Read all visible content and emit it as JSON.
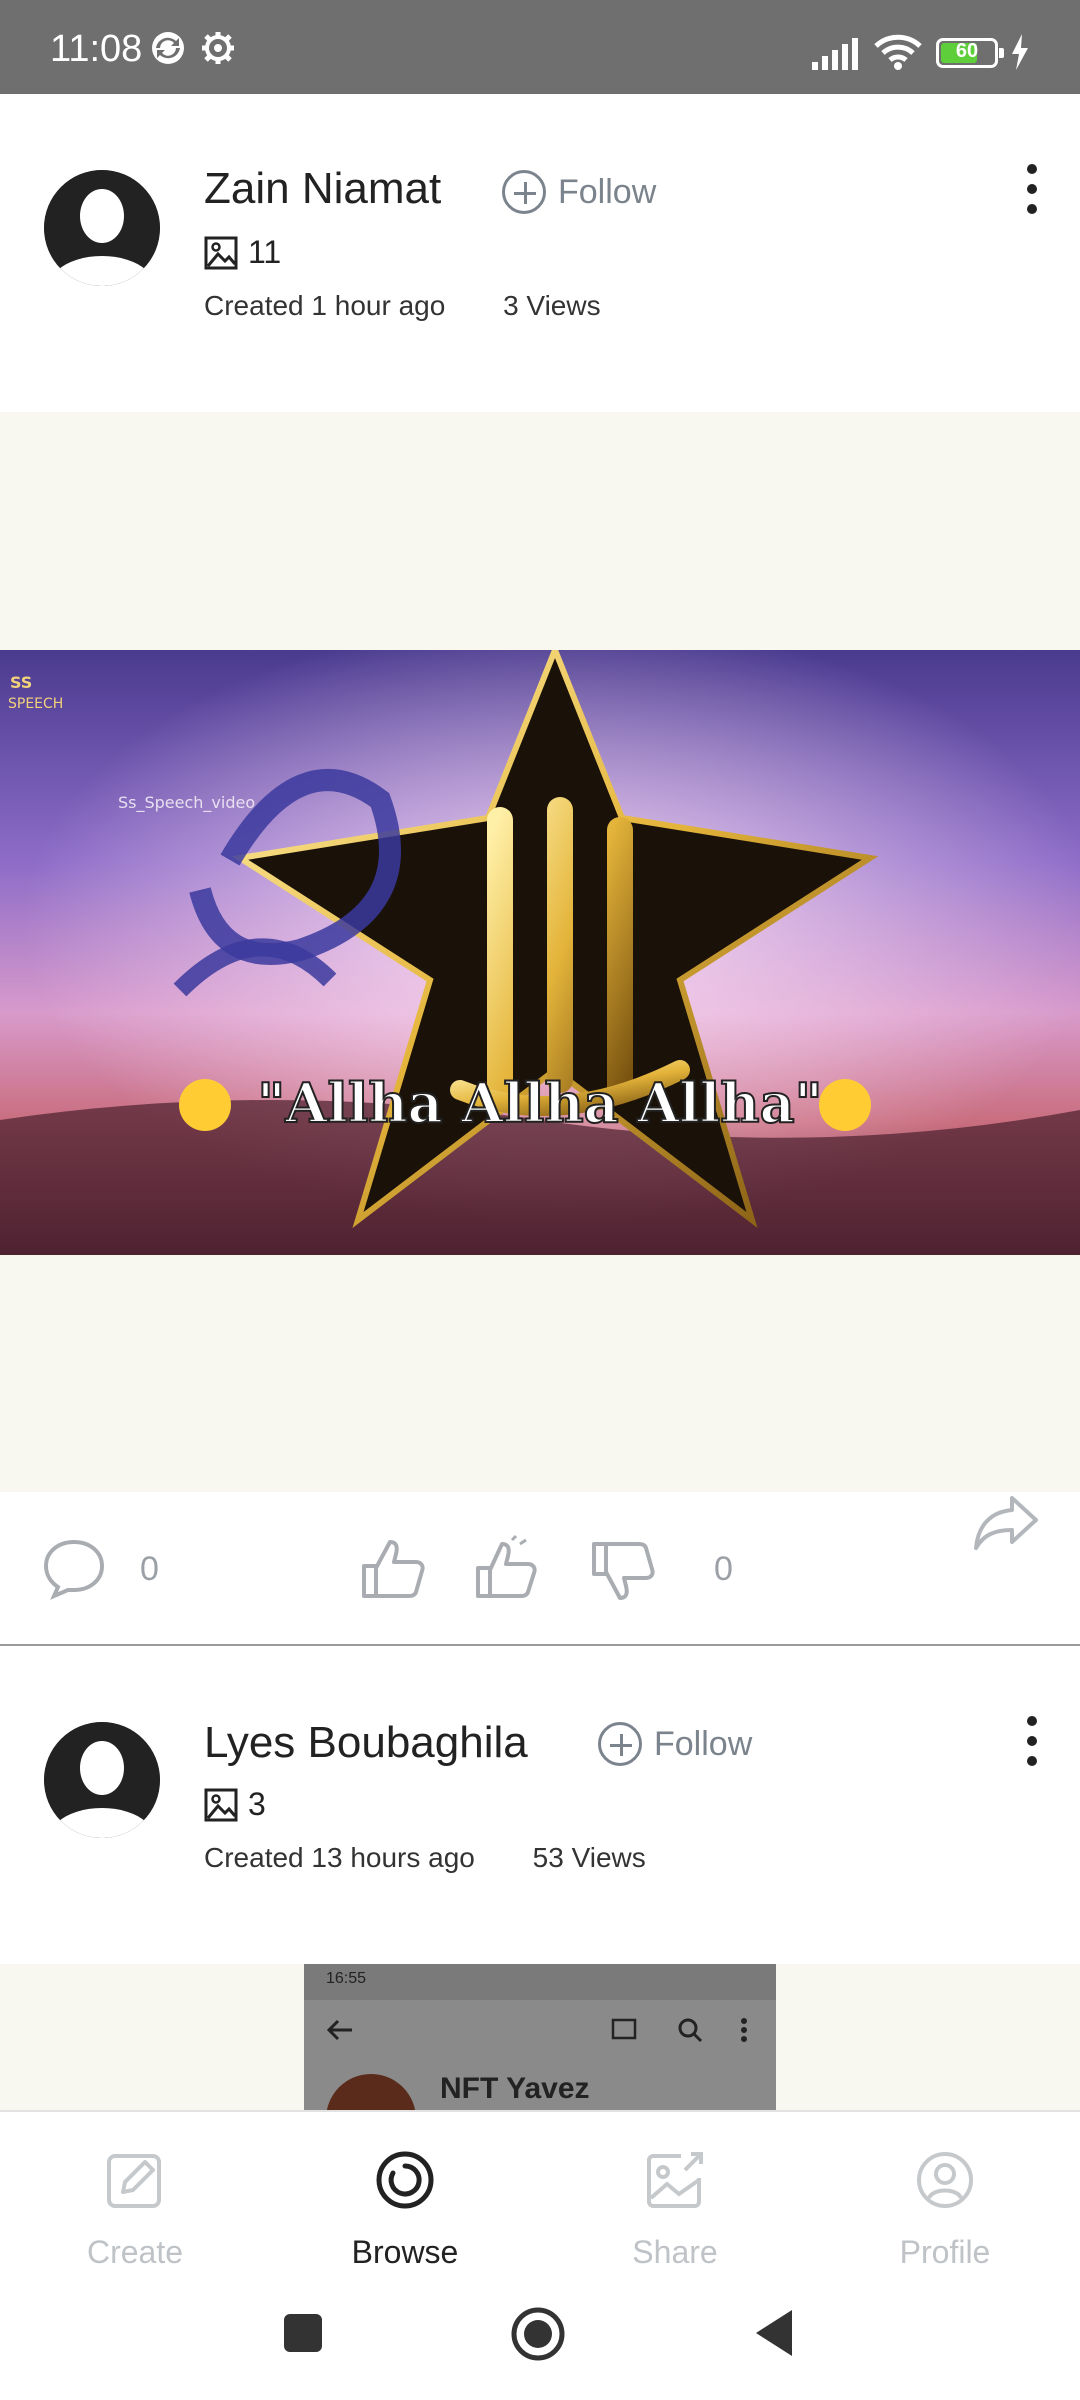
{
  "status_bar": {
    "time": "11:08",
    "battery": "60",
    "icons": [
      "sync-icon",
      "gear-icon",
      "signal-icon",
      "wifi-icon",
      "battery-icon",
      "charging-icon"
    ]
  },
  "posts": [
    {
      "username": "Zain Niamat",
      "follow_label": "Follow",
      "image_count": "11",
      "created": "Created 1 hour ago",
      "views": "3 Views",
      "overlay_watermark": "Ss_Speech_video",
      "overlay_logo": "SS SPEECH",
      "overlay_caption": "\"Allha Allha Allha\"",
      "comments_count": "0",
      "votes_count": "0"
    },
    {
      "username": "Lyes Boubaghila",
      "follow_label": "Follow",
      "image_count": "3",
      "created": "Created 13 hours ago",
      "views": "53 Views",
      "preview_time": "16:55",
      "preview_title": "NFT Yavez"
    }
  ],
  "bottom_nav": {
    "items": [
      {
        "label": "Create",
        "icon": "pencil-icon"
      },
      {
        "label": "Browse",
        "icon": "browse-icon",
        "active": true
      },
      {
        "label": "Share",
        "icon": "share-image-icon"
      },
      {
        "label": "Profile",
        "icon": "profile-icon"
      }
    ]
  },
  "colors": {
    "status_bar": "#6f6f6f",
    "media_bg": "#f8f7f0",
    "muted": "#7b838d",
    "battery_fill": "#5fce3b"
  }
}
